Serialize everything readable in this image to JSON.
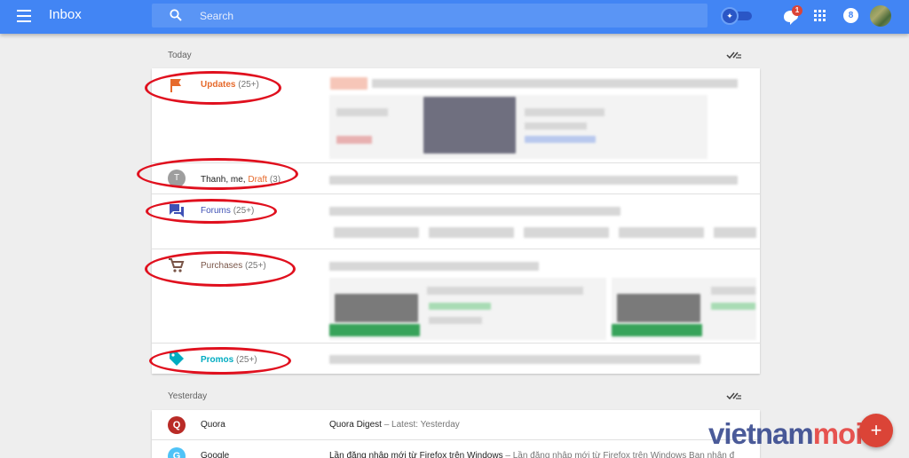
{
  "header": {
    "title": "Inbox",
    "search_placeholder": "Search",
    "hangouts_badge": "1",
    "notifications_count": "8"
  },
  "colors": {
    "header_blue": "#4285f4",
    "updates": "#e66a2c",
    "forums": "#3f51b5",
    "purchases": "#795548",
    "promos": "#00acc1",
    "draft": "#e66a2c",
    "annotation": "#e0101e"
  },
  "today": {
    "label": "Today",
    "rows": [
      {
        "icon": "flag-icon",
        "title": "Updates",
        "count": "(25+)"
      },
      {
        "icon": "avatar-t",
        "avatar_letter": "T",
        "title_prefix": "Thanh, me, ",
        "draft": "Draft",
        "count": "(3)"
      },
      {
        "icon": "forum-icon",
        "title": "Forums",
        "count": "(25+)"
      },
      {
        "icon": "cart-icon",
        "title": "Purchases",
        "count": "(25+)"
      },
      {
        "icon": "tag-icon",
        "title": "Promos",
        "count": "(25+)"
      }
    ]
  },
  "yesterday": {
    "label": "Yesterday",
    "rows": [
      {
        "avatar_letter": "Q",
        "avatar_color": "#b92b27",
        "sender": "Quora",
        "subject": "Quora Digest",
        "snippet": " – Latest: Yesterday"
      },
      {
        "avatar_letter": "G",
        "avatar_color": "#4fc3f7",
        "sender": "Google",
        "subject": "Lần đăng nhập mới từ Firefox trên Windows",
        "snippet": " – Lần đăng nhập mới từ Firefox trên Windows Bạn nhận đ"
      }
    ]
  },
  "fab_label": "+",
  "watermark": {
    "part1": "vietnam",
    "part2": "moi"
  }
}
